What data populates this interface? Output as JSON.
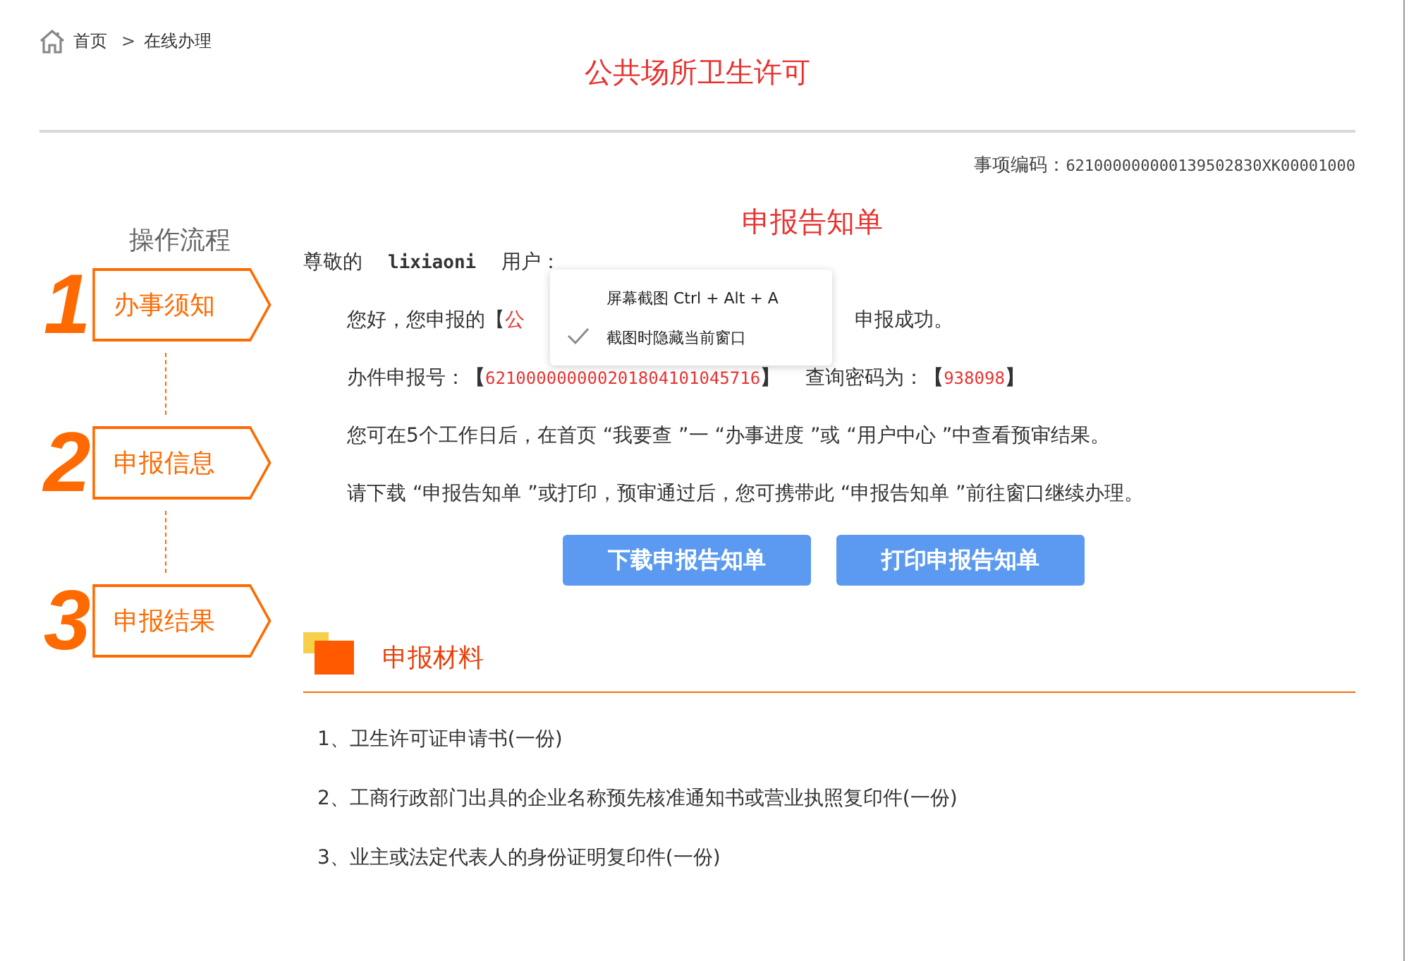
{
  "breadcrumb": [
    {
      "label": "首页"
    },
    {
      "label": "在线办理"
    }
  ],
  "breadcrumb_separator": ">",
  "page_title": "公共场所卫生许可",
  "item_code": {
    "label": "事项编码：",
    "value": "621000000000139502830XK00001000"
  },
  "process": {
    "title": "操作流程",
    "steps": [
      {
        "number": "1",
        "label": "办事须知"
      },
      {
        "number": "2",
        "label": "申报信息"
      },
      {
        "number": "3",
        "label": "申报结果"
      }
    ]
  },
  "notice": {
    "title": "申报告知单",
    "greeting_prefix": "尊敬的",
    "username": "lixiaoni",
    "greeting_suffix": "用户：",
    "success": {
      "prefix": "您好，您申报的【",
      "highlight": "公",
      "suffix": "申报成功。"
    },
    "case_number": {
      "label": "办件申报号：",
      "open": "【",
      "value": "621000000000201804101045716",
      "close": "】"
    },
    "password": {
      "label": "查询密码为：",
      "open": "【",
      "value": "938098",
      "close": "】"
    },
    "paragraphs": [
      "您可在5个工作日后，在首页 “我要查 ”一 “办事进度 ”或 “用户中心 ”中查看预审结果。",
      "请下载 “申报告知单 ”或打印，预审通过后，您可携带此 “申报告知单 ”前往窗口继续办理。"
    ],
    "buttons": [
      "下载申报告知单",
      "打印申报告知单"
    ]
  },
  "materials": {
    "title": "申报材料",
    "items": [
      "1、卫生许可证申请书(一份)",
      "2、工商行政部门出具的企业名称预先核准通知书或营业执照复印件(一份)",
      "3、业主或法定代表人的身份证明复印件(一份)"
    ]
  },
  "context_menu": {
    "items": [
      {
        "label": "屏幕截图",
        "shortcut": "Ctrl + Alt + A",
        "checked": false
      },
      {
        "label": "截图时隐藏当前窗口",
        "checked": true
      }
    ]
  }
}
